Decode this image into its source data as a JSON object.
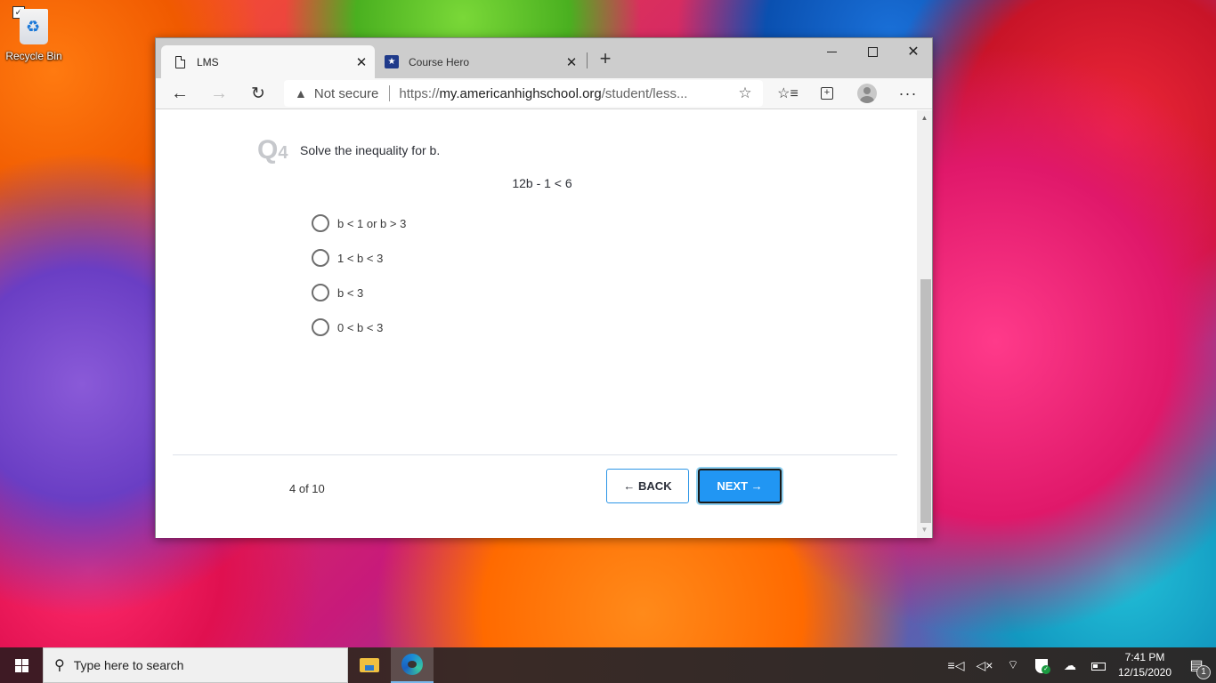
{
  "desktop": {
    "icons": [
      {
        "label": "Recycle Bin",
        "icon": "recycle-bin-icon",
        "checked": true
      }
    ]
  },
  "browser": {
    "tabs": [
      {
        "title": "LMS",
        "icon": "document-icon",
        "active": true,
        "close": "✕"
      },
      {
        "title": "Course Hero",
        "icon": "course-hero-icon",
        "active": false,
        "close": "✕"
      }
    ],
    "new_tab": "+",
    "window_controls": {
      "minimize": "minimize",
      "maximize": "maximize",
      "close": "✕"
    },
    "toolbar": {
      "back": "←",
      "forward": "→",
      "reload": "↻",
      "security_icon": "▲",
      "security_text": "Not secure",
      "url_prefix": "https://",
      "url_domain": "my.americanhighschool.org",
      "url_path": "/student/less...",
      "favorite_icon": "☆",
      "favorites_icon": "☆≡",
      "collections_icon": "+",
      "more": "···"
    }
  },
  "quiz": {
    "question_prefix": "Q",
    "question_number": "4",
    "question_text": "Solve the inequality for b.",
    "equation": "12b - 1 < 6",
    "options": [
      {
        "label": "b < 1 or b > 3",
        "selected": false
      },
      {
        "label": "1 < b < 3",
        "selected": false
      },
      {
        "label": "b < 3",
        "selected": false
      },
      {
        "label": "0 < b < 3",
        "selected": false
      }
    ],
    "progress_text": "4 of 10",
    "back_label": "BACK",
    "back_arrow": "🡐",
    "next_label": "NEXT",
    "next_arrow": "🡒",
    "accent_color": "#2196f3"
  },
  "scrollbar": {
    "position_fraction": 0.59,
    "visible_fraction": 0.59
  },
  "taskbar": {
    "search_placeholder": "Type here to search",
    "search_icon": "⚲",
    "pinned_apps": [
      "File Explorer",
      "Microsoft Edge"
    ],
    "tray": {
      "task_view": "≡◁",
      "volume": "◁×",
      "wifi": "◝",
      "onedrive": "☁",
      "time": "7:41 PM",
      "date": "12/15/2020",
      "notifications_icon": "🗨",
      "notification_count": "1"
    }
  }
}
